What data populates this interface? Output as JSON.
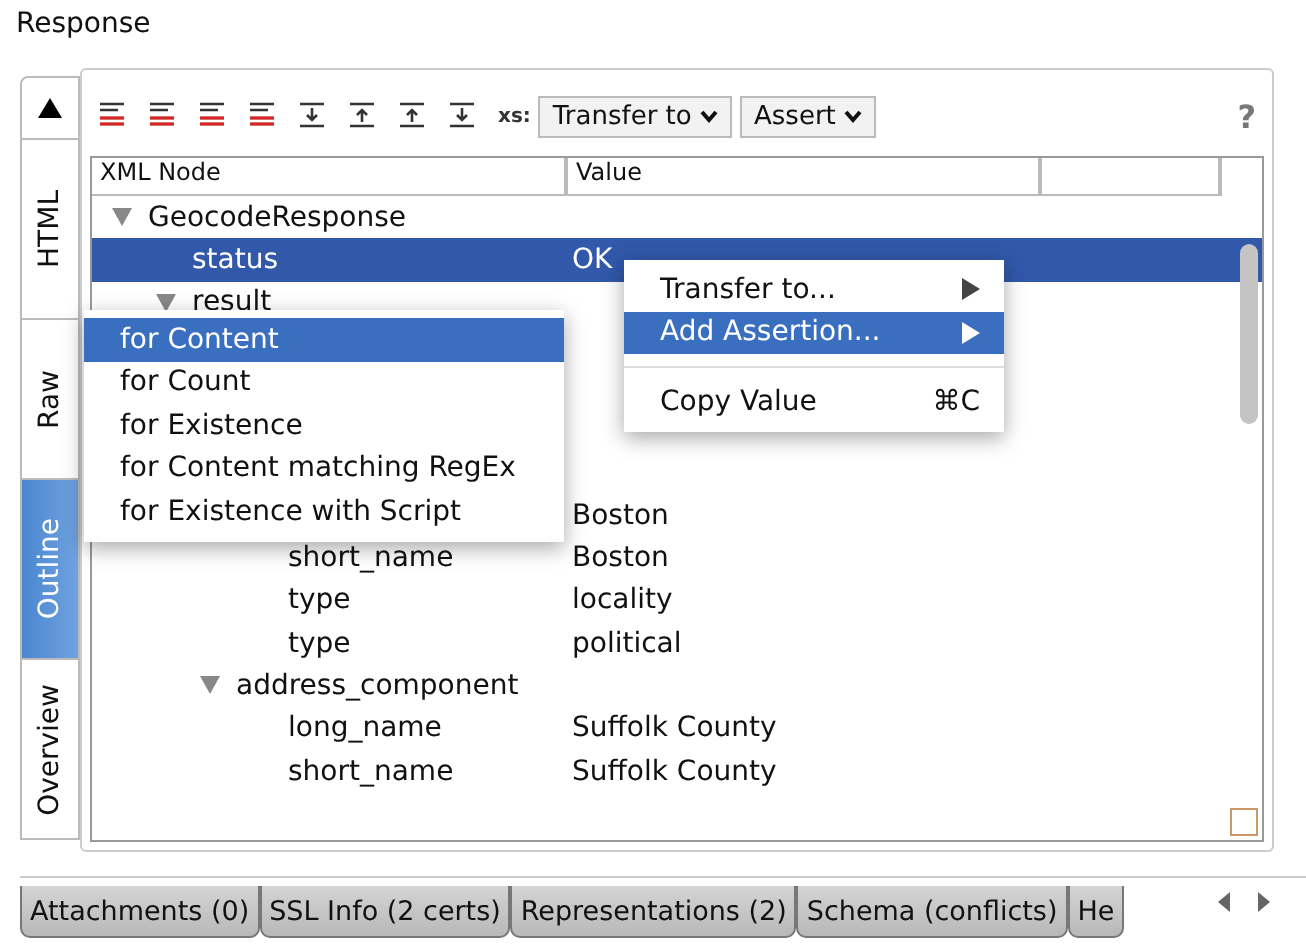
{
  "title": "Response",
  "side_tabs": [
    {
      "label": "HTML",
      "selected": false
    },
    {
      "label": "Raw",
      "selected": false
    },
    {
      "label": "Outline",
      "selected": true
    },
    {
      "label": "Overview",
      "selected": false
    }
  ],
  "toolbar": {
    "icons": [
      {
        "kind": "lines"
      },
      {
        "kind": "lines"
      },
      {
        "kind": "lines"
      },
      {
        "kind": "lines"
      },
      {
        "kind": "down"
      },
      {
        "kind": "up"
      },
      {
        "kind": "up"
      },
      {
        "kind": "down"
      }
    ],
    "xs_label": "xs:",
    "buttons": [
      "Transfer to",
      "Assert"
    ],
    "help": "?"
  },
  "table": {
    "columns": [
      "XML Node",
      "Value"
    ],
    "tree": [
      {
        "name": "GeocodeResponse",
        "expanded": true,
        "selected": false,
        "children": [
          {
            "name": "status",
            "value": "OK",
            "selected": true
          },
          {
            "name": "result",
            "expanded": true,
            "selected": false,
            "children": [
              {
                "selected": false
              },
              {
                "selected": false
              },
              {
                "selected": false
              },
              {
                "selected": false,
                "children": [
                  {
                    "value": "Boston",
                    "selected": false
                  },
                  {
                    "name": "short_name",
                    "value": "Boston",
                    "selected": false
                  },
                  {
                    "name": "type",
                    "value": "locality",
                    "selected": false
                  },
                  {
                    "name": "type",
                    "value": "political",
                    "selected": false
                  }
                ]
              },
              {
                "name": "address_component",
                "expanded": true,
                "selected": false,
                "children": [
                  {
                    "name": "long_name",
                    "value": "Suffolk County",
                    "selected": false
                  },
                  {
                    "name": "short_name",
                    "value": "Suffolk County",
                    "selected": false
                  }
                ]
              }
            ]
          }
        ]
      }
    ]
  },
  "context_menu": [
    {
      "label": "Transfer to...",
      "submenu": true,
      "selected": false
    },
    {
      "label": "Add Assertion...",
      "submenu": true,
      "selected": true
    },
    {
      "kind": "separator"
    },
    {
      "label": "Copy Value",
      "shortcut": "⌘C",
      "selected": false
    }
  ],
  "submenu": [
    {
      "label": "for Content",
      "selected": true
    },
    {
      "label": "for Count",
      "selected": false
    },
    {
      "label": "for Existence",
      "selected": false
    },
    {
      "label": "for Content matching RegEx",
      "selected": false
    },
    {
      "label": "for Existence with Script",
      "selected": false
    }
  ],
  "bottom_tabs": [
    {
      "label": "Attachments (0)",
      "selected": false
    },
    {
      "label": "SSL Info (2 certs)",
      "selected": false
    },
    {
      "label": "Representations (2)",
      "selected": false
    },
    {
      "label": "Schema (conflicts)",
      "selected": false
    },
    {
      "label": "He",
      "selected": false
    }
  ]
}
